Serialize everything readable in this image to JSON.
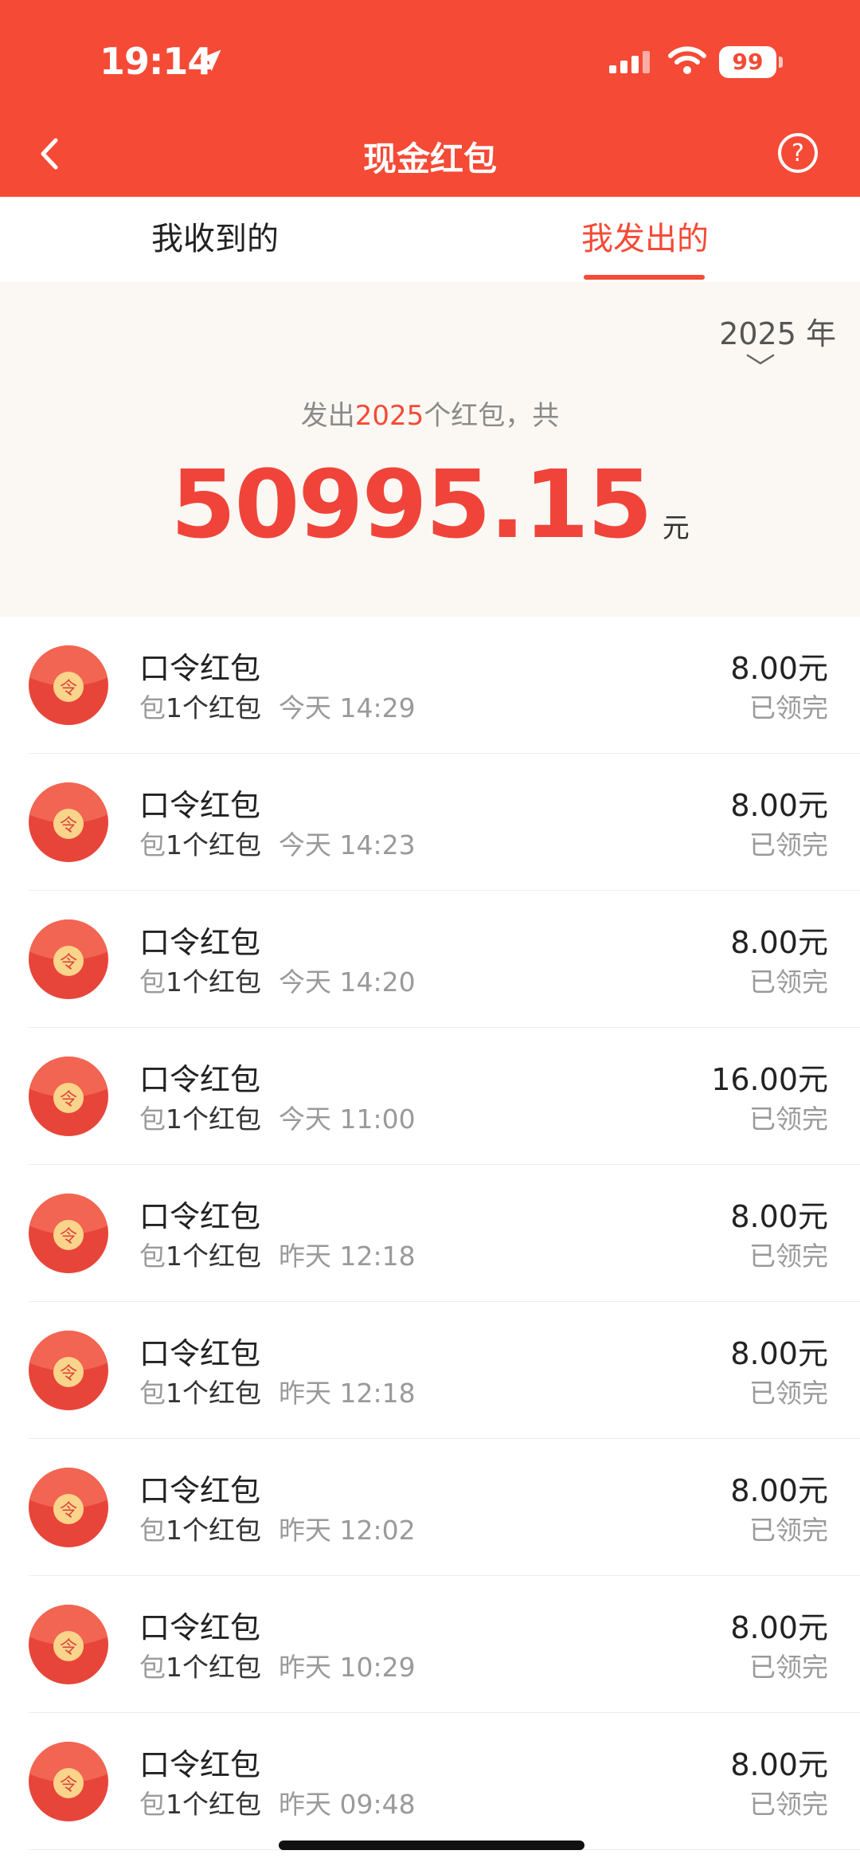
{
  "status_bar": {
    "time": "19:14",
    "battery": "99"
  },
  "nav": {
    "title": "现金红包"
  },
  "tabs": [
    {
      "label": "我收到的",
      "active": false
    },
    {
      "label": "我发出的",
      "active": true
    }
  ],
  "summary": {
    "year": "2025 年",
    "prefix": "发出",
    "count": "2025",
    "suffix": "个红包，共",
    "total": "50995.15",
    "unit": "元"
  },
  "items": [
    {
      "title": "口令红包",
      "prefix": "包",
      "qty": "1个红包",
      "time": "今天 14:29",
      "amount": "8.00元",
      "status": "已领完"
    },
    {
      "title": "口令红包",
      "prefix": "包",
      "qty": "1个红包",
      "time": "今天 14:23",
      "amount": "8.00元",
      "status": "已领完"
    },
    {
      "title": "口令红包",
      "prefix": "包",
      "qty": "1个红包",
      "time": "今天 14:20",
      "amount": "8.00元",
      "status": "已领完"
    },
    {
      "title": "口令红包",
      "prefix": "包",
      "qty": "1个红包",
      "time": "今天 11:00",
      "amount": "16.00元",
      "status": "已领完"
    },
    {
      "title": "口令红包",
      "prefix": "包",
      "qty": "1个红包",
      "time": "昨天 12:18",
      "amount": "8.00元",
      "status": "已领完"
    },
    {
      "title": "口令红包",
      "prefix": "包",
      "qty": "1个红包",
      "time": "昨天 12:18",
      "amount": "8.00元",
      "status": "已领完"
    },
    {
      "title": "口令红包",
      "prefix": "包",
      "qty": "1个红包",
      "time": "昨天 12:02",
      "amount": "8.00元",
      "status": "已领完"
    },
    {
      "title": "口令红包",
      "prefix": "包",
      "qty": "1个红包",
      "time": "昨天 10:29",
      "amount": "8.00元",
      "status": "已领完"
    },
    {
      "title": "口令红包",
      "prefix": "包",
      "qty": "1个红包",
      "time": "昨天 09:48",
      "amount": "8.00元",
      "status": "已领完"
    }
  ],
  "envelope_glyph": "令",
  "colors": {
    "brand_red": "#f54a36",
    "summary_bg": "#fbf8f4",
    "envelope_red": "#e8453a",
    "envelope_seal": "#f9d48a"
  },
  "icons": {
    "back": "chevron-left-icon",
    "help": "question-circle-icon",
    "location": "location-arrow-icon",
    "signal": "cellular-signal-icon",
    "wifi": "wifi-icon",
    "envelope": "red-envelope-icon"
  }
}
